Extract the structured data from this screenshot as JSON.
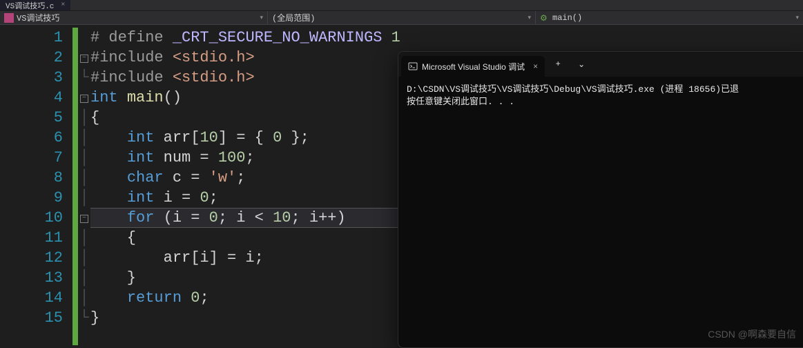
{
  "tabs": {
    "file_name": "VS调试技巧.c"
  },
  "navbar": {
    "file_label": "VS调试技巧",
    "scope_label": "(全局范围)",
    "function_label": "main()"
  },
  "editor": {
    "line_numbers": [
      "1",
      "2",
      "3",
      "4",
      "5",
      "6",
      "7",
      "8",
      "9",
      "10",
      "11",
      "12",
      "13",
      "14",
      "15"
    ],
    "highlighted_line": 10,
    "code_tokens": [
      [
        {
          "t": "# define ",
          "c": "tk-pp"
        },
        {
          "t": "_CRT_SECURE_NO_WARNINGS",
          "c": "tk-macro"
        },
        {
          "t": " 1",
          "c": "tk-num"
        }
      ],
      [
        {
          "t": "#include ",
          "c": "tk-pp"
        },
        {
          "t": "<stdio.h>",
          "c": "tk-inc"
        }
      ],
      [
        {
          "t": "#include ",
          "c": "tk-pp"
        },
        {
          "t": "<stdio.h>",
          "c": "tk-inc"
        }
      ],
      [
        {
          "t": "int",
          "c": "tk-type"
        },
        {
          "t": " ",
          "c": "tk-p"
        },
        {
          "t": "main",
          "c": "tk-fn"
        },
        {
          "t": "()",
          "c": "tk-p"
        }
      ],
      [
        {
          "t": "{",
          "c": "tk-p"
        }
      ],
      [
        {
          "t": "    ",
          "c": "tk-p"
        },
        {
          "t": "int",
          "c": "tk-type"
        },
        {
          "t": " arr[",
          "c": "tk-p"
        },
        {
          "t": "10",
          "c": "tk-num"
        },
        {
          "t": "] = { ",
          "c": "tk-p"
        },
        {
          "t": "0",
          "c": "tk-num"
        },
        {
          "t": " };",
          "c": "tk-p"
        }
      ],
      [
        {
          "t": "    ",
          "c": "tk-p"
        },
        {
          "t": "int",
          "c": "tk-type"
        },
        {
          "t": " num = ",
          "c": "tk-p"
        },
        {
          "t": "100",
          "c": "tk-num"
        },
        {
          "t": ";",
          "c": "tk-p"
        }
      ],
      [
        {
          "t": "    ",
          "c": "tk-p"
        },
        {
          "t": "char",
          "c": "tk-type"
        },
        {
          "t": " c = ",
          "c": "tk-p"
        },
        {
          "t": "'w'",
          "c": "tk-char"
        },
        {
          "t": ";",
          "c": "tk-p"
        }
      ],
      [
        {
          "t": "    ",
          "c": "tk-p"
        },
        {
          "t": "int",
          "c": "tk-type"
        },
        {
          "t": " i = ",
          "c": "tk-p"
        },
        {
          "t": "0",
          "c": "tk-num"
        },
        {
          "t": ";",
          "c": "tk-p"
        }
      ],
      [
        {
          "t": "    ",
          "c": "tk-p"
        },
        {
          "t": "for",
          "c": "tk-kw"
        },
        {
          "t": " (i = ",
          "c": "tk-p"
        },
        {
          "t": "0",
          "c": "tk-num"
        },
        {
          "t": "; i < ",
          "c": "tk-p"
        },
        {
          "t": "10",
          "c": "tk-num"
        },
        {
          "t": "; i++)",
          "c": "tk-p"
        }
      ],
      [
        {
          "t": "    {",
          "c": "tk-p"
        }
      ],
      [
        {
          "t": "        arr[i] = i;",
          "c": "tk-p"
        }
      ],
      [
        {
          "t": "    }",
          "c": "tk-p"
        }
      ],
      [
        {
          "t": "    ",
          "c": "tk-p"
        },
        {
          "t": "return",
          "c": "tk-kw"
        },
        {
          "t": " ",
          "c": "tk-p"
        },
        {
          "t": "0",
          "c": "tk-num"
        },
        {
          "t": ";",
          "c": "tk-p"
        }
      ],
      [
        {
          "t": "}",
          "c": "tk-p"
        }
      ]
    ],
    "fold_markers": {
      "2": "minus",
      "4": "minus",
      "10": "minus"
    },
    "line_guide": {
      "3": "L",
      "5": "|",
      "6": "|",
      "7": "|",
      "8": "|",
      "9": "|",
      "11": "||",
      "12": "||",
      "13": "||",
      "14": "|",
      "15": "L"
    }
  },
  "terminal": {
    "tab_title": "Microsoft Visual Studio 调试",
    "lines": [
      "D:\\CSDN\\VS调试技巧\\VS调试技巧\\Debug\\VS调试技巧.exe (进程 18656)已退",
      "按任意键关闭此窗口. . ."
    ]
  },
  "watermark": "CSDN @啊森要自信"
}
